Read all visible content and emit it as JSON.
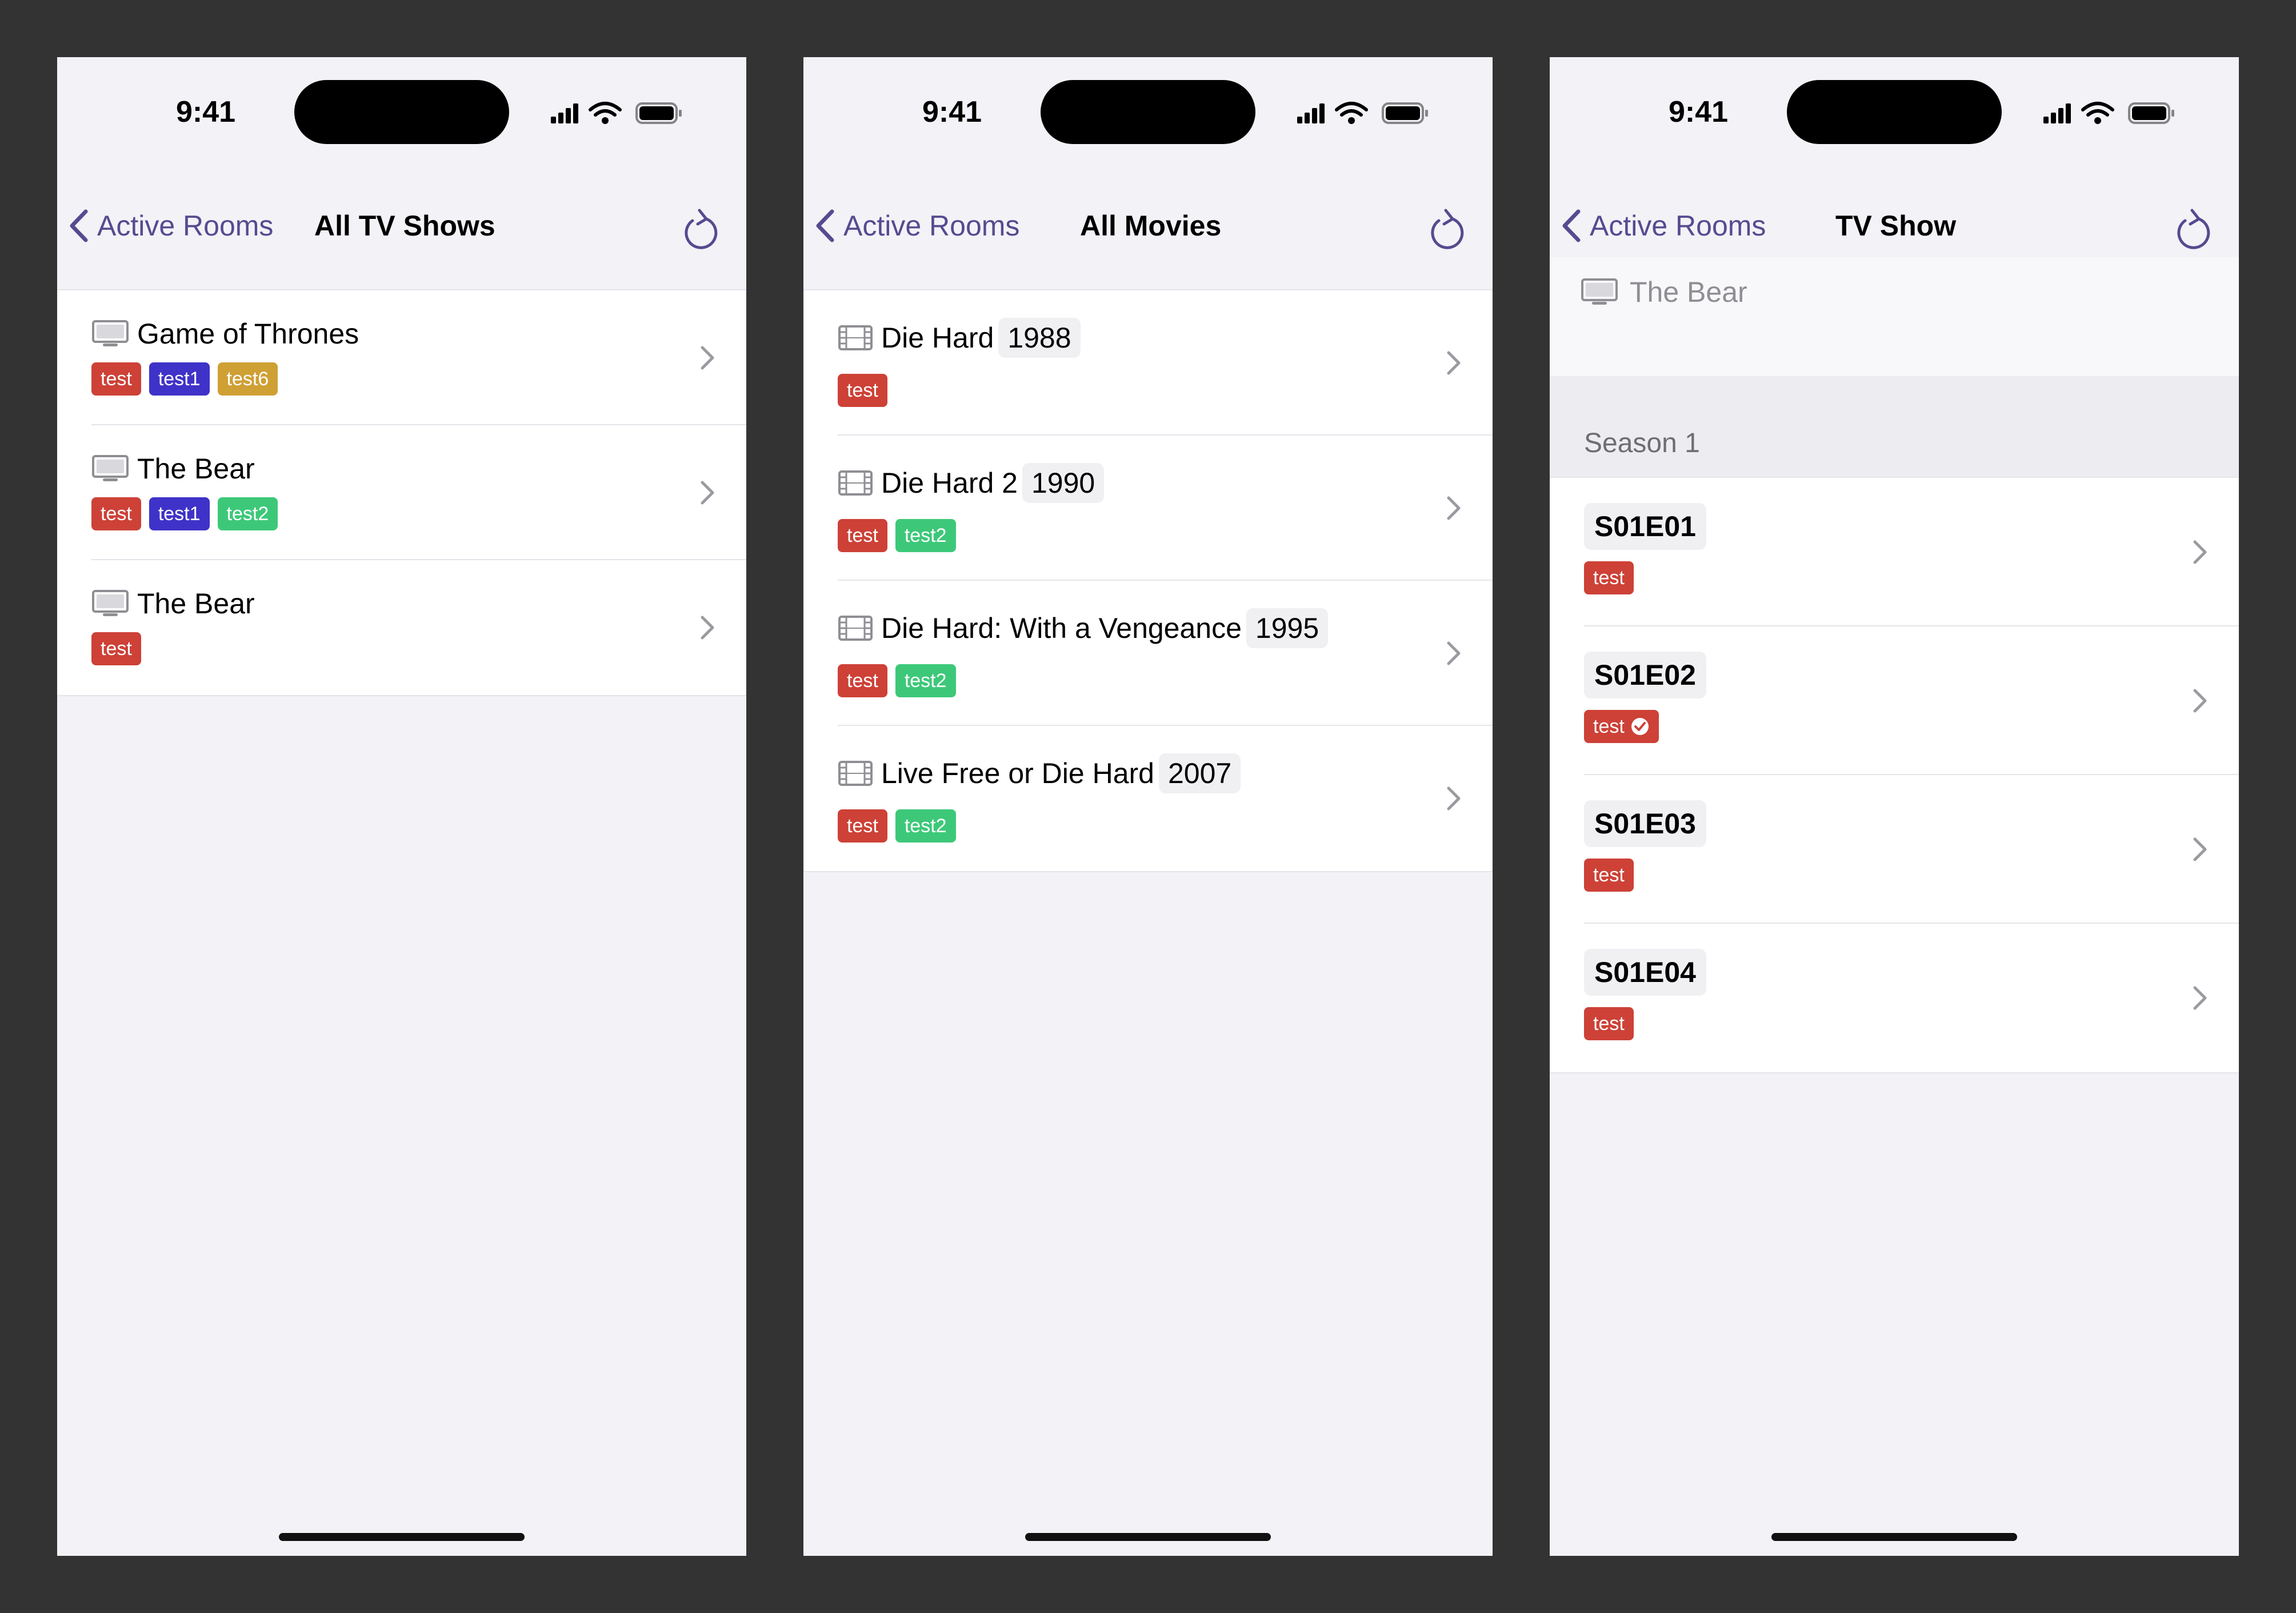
{
  "status_bar": {
    "time": "9:41"
  },
  "colors": {
    "accent": "#574a8f",
    "tag_red": "#cd4137",
    "tag_blue": "#3f32c8",
    "tag_gold": "#cfa034",
    "tag_green": "#3dc879"
  },
  "screen1": {
    "back_label": "Active Rooms",
    "title": "All TV Shows",
    "rows": [
      {
        "title": "Game of Thrones",
        "icon": "tv-icon",
        "tags": [
          "test",
          "test1",
          "test6"
        ]
      },
      {
        "title": "The Bear",
        "icon": "tv-icon",
        "tags": [
          "test",
          "test1",
          "test2"
        ]
      },
      {
        "title": "The Bear",
        "icon": "tv-icon",
        "tags": [
          "test"
        ]
      }
    ]
  },
  "screen2": {
    "back_label": "Active Rooms",
    "title": "All Movies",
    "rows": [
      {
        "title": "Die Hard",
        "year": "1988",
        "icon": "film-icon",
        "tags": [
          "test"
        ]
      },
      {
        "title": "Die Hard 2",
        "year": "1990",
        "icon": "film-icon",
        "tags": [
          "test",
          "test2"
        ]
      },
      {
        "title": "Die Hard: With a Vengeance",
        "year": "1995",
        "icon": "film-icon",
        "tags": [
          "test",
          "test2"
        ]
      },
      {
        "title": "Live Free or Die Hard",
        "year": "2007",
        "icon": "film-icon",
        "tags": [
          "test",
          "test2"
        ]
      }
    ]
  },
  "screen3": {
    "back_label": "Active Rooms",
    "title": "TV Show",
    "show_title": "The Bear",
    "season_header": "Season 1",
    "episodes": [
      {
        "label": "S01E01",
        "tag": "test",
        "checked": false
      },
      {
        "label": "S01E02",
        "tag": "test",
        "checked": true
      },
      {
        "label": "S01E03",
        "tag": "test",
        "checked": false
      },
      {
        "label": "S01E04",
        "tag": "test",
        "checked": false
      }
    ]
  }
}
